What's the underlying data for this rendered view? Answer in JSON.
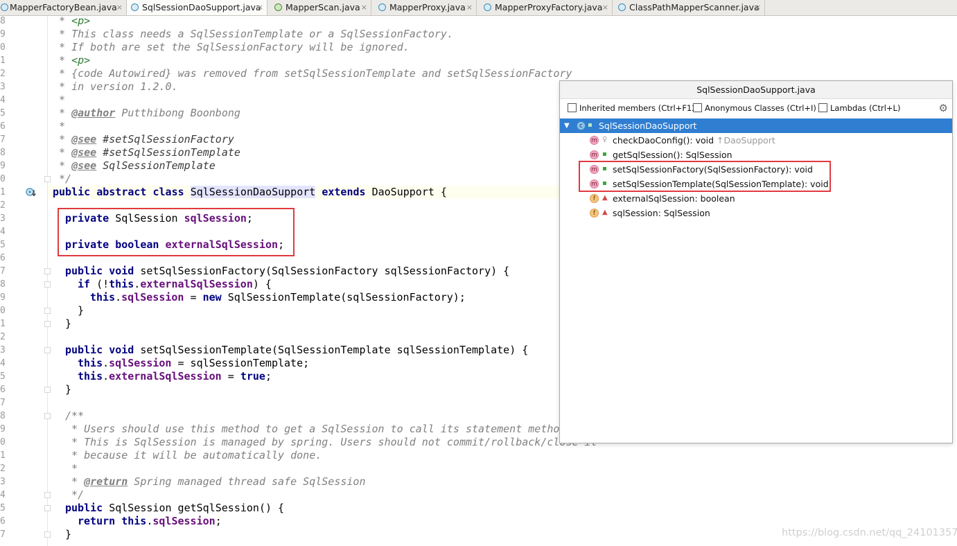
{
  "tabs": [
    {
      "label": "MapperFactoryBean.java",
      "kind": "class",
      "active": false
    },
    {
      "label": "SqlSessionDaoSupport.java",
      "kind": "class",
      "active": true
    },
    {
      "label": "MapperScan.java",
      "kind": "annotation",
      "active": false
    },
    {
      "label": "MapperProxy.java",
      "kind": "class",
      "active": false
    },
    {
      "label": "MapperProxyFactory.java",
      "kind": "class",
      "active": false
    },
    {
      "label": "ClassPathMapperScanner.java",
      "kind": "class",
      "active": false
    }
  ],
  "tab_close_glyph": "×",
  "line_numbers": [
    "8",
    "9",
    "0",
    "1",
    "2",
    "3",
    "4",
    "5",
    "6",
    "7",
    "8",
    "9",
    "0",
    "1",
    "2",
    "3",
    "4",
    "5",
    "6",
    "7",
    "8",
    "9",
    "0",
    "1",
    "2",
    "3",
    "4",
    "5",
    "6",
    "7",
    "8",
    "9",
    "0",
    "1",
    "2",
    "3",
    "4",
    "5",
    "6",
    "7"
  ],
  "code": {
    "l1_star": " * ",
    "l1_tag": "<p>",
    "l2": " * This class needs a SqlSessionTemplate or a SqlSessionFactory.",
    "l3": " * If both are set the SqlSessionFactory will be ignored.",
    "l4_star": " * ",
    "l4_tag": "<p>",
    "l5": " * {code Autowired} was removed from setSqlSessionTemplate and setSqlSessionFactory",
    "l6": " * in version 1.2.0.",
    "l7": " *",
    "l8_star": " * ",
    "l8_tag": "@author",
    "l8_rest": " Putthibong Boonbong",
    "l9": " *",
    "l10_star": " * ",
    "l10_tag": "@see",
    "l10_rest": " #setSqlSessionFactory",
    "l11_star": " * ",
    "l11_tag": "@see",
    "l11_rest": " #setSqlSessionTemplate",
    "l12_star": " * ",
    "l12_tag": "@see",
    "l12_rest": " SqlSessionTemplate",
    "l13": " */",
    "l14_kw": "public abstract class ",
    "l14_name": "SqlSessionDaoSupport",
    "l14_kw2": " extends ",
    "l14_rest": "DaoSupport {",
    "l16_kw": "private ",
    "l16_type": "SqlSession ",
    "l16_fld": "sqlSession",
    "l16_end": ";",
    "l18_kw": "private boolean ",
    "l18_fld": "externalSqlSession",
    "l18_end": ";",
    "l20_kw": "public void ",
    "l20_rest": "setSqlSessionFactory(SqlSessionFactory sqlSessionFactory) {",
    "l21_kw": "if ",
    "l21_a": "(!",
    "l21_this": "this",
    "l21_dot": ".",
    "l21_fld": "externalSqlSession",
    "l21_end": ") {",
    "l22_this": "this",
    "l22_dot": ".",
    "l22_fld": "sqlSession",
    "l22_eq": " = ",
    "l22_new": "new ",
    "l22_rest": "SqlSessionTemplate(sqlSessionFactory);",
    "l23": "}",
    "l24": "}",
    "l26_kw": "public void ",
    "l26_rest": "setSqlSessionTemplate(SqlSessionTemplate sqlSessionTemplate) {",
    "l27_this": "this",
    "l27_dot": ".",
    "l27_fld": "sqlSession",
    "l27_rest": " = sqlSessionTemplate;",
    "l28_this": "this",
    "l28_dot": ".",
    "l28_fld": "externalSqlSession",
    "l28_eq": " = ",
    "l28_true": "true",
    "l28_end": ";",
    "l29": "}",
    "l31": "/**",
    "l32": " * Users should use this method to get a SqlSession to call its statement method",
    "l33": " * This is SqlSession is managed by spring. Users should not commit/rollback/close it",
    "l34": " * because it will be automatically done.",
    "l35": " *",
    "l36_star": " * ",
    "l36_tag": "@return",
    "l36_rest": " Spring managed thread safe SqlSession",
    "l37": " */",
    "l38_kw": "public ",
    "l38_rest": "SqlSession getSqlSession() {",
    "l39_kw": "return ",
    "l39_this": "this",
    "l39_dot": ".",
    "l39_fld": "sqlSession",
    "l39_end": ";",
    "l40": "}"
  },
  "popup": {
    "title": "SqlSessionDaoSupport.java",
    "options": {
      "inherited": "Inherited members (Ctrl+F12)",
      "anonymous": "Anonymous Classes (Ctrl+I)",
      "lambdas": "Lambdas (Ctrl+L)"
    },
    "gear_glyph": "⚙",
    "root": {
      "label": "SqlSessionDaoSupport",
      "badge": "c"
    },
    "members": [
      {
        "label": "checkDaoConfig(): void",
        "inherited": "↑DaoSupport",
        "badge": "m",
        "visibility": "protected"
      },
      {
        "label": "getSqlSession(): SqlSession",
        "badge": "m",
        "visibility": "public"
      },
      {
        "label": "setSqlSessionFactory(SqlSessionFactory): void",
        "badge": "m",
        "visibility": "public"
      },
      {
        "label": "setSqlSessionTemplate(SqlSessionTemplate): void",
        "badge": "m",
        "visibility": "public"
      },
      {
        "label": "externalSqlSession: boolean",
        "badge": "f",
        "visibility": "private"
      },
      {
        "label": "sqlSession: SqlSession",
        "badge": "f",
        "visibility": "private"
      }
    ],
    "expander_glyph": "▼",
    "vis_glyphs": {
      "public": "▪",
      "protected": "♀",
      "private": "▲"
    }
  },
  "watermark": "https://blog.csdn.net/qq_24101357",
  "colors": {
    "highlight_box": "#e0393e",
    "selection": "#2f7ed1"
  }
}
